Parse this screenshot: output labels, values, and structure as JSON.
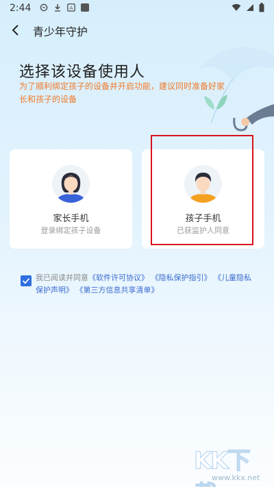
{
  "status_bar": {
    "time": "2:44",
    "icons": [
      "message-icon",
      "download-icon",
      "app-badge-icon",
      "square-icon",
      "wifi-icon",
      "signal-icon",
      "battery-icon"
    ]
  },
  "header": {
    "title": "青少年守护"
  },
  "main": {
    "heading": "选择该设备使用人",
    "subtitle": "为了顺利绑定孩子的设备并开启功能，建议同时准备好家长和孩子的设备"
  },
  "cards": {
    "parent": {
      "title": "家长手机",
      "desc": "登录绑定孩子设备"
    },
    "child": {
      "title": "孩子手机",
      "desc": "已获监护人同意"
    }
  },
  "agreement": {
    "checked": true,
    "prefix": "我已阅读并同意",
    "link1": "《软件许可协议》",
    "link2": "《隐私保护指引》",
    "link3": "《儿童隐私保护声明》",
    "link4": "《第三方信息共享清单》"
  },
  "watermark": {
    "logo": "KK下载",
    "url": "www.kkx.net"
  },
  "colors": {
    "accent_orange": "#f07a2a",
    "link_blue": "#3a6bd0",
    "checkbox_blue": "#2f6fe0",
    "highlight_red": "#d9101a"
  }
}
